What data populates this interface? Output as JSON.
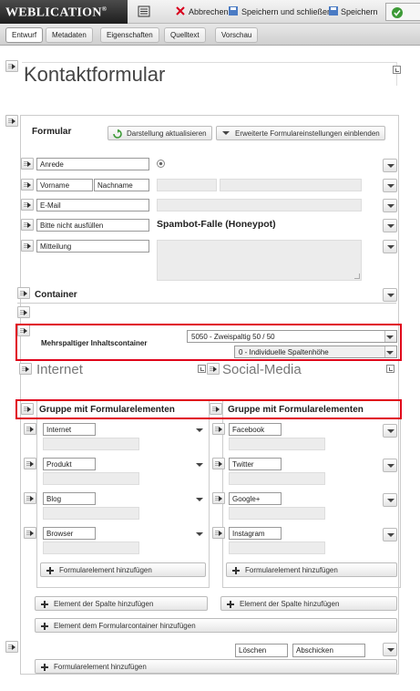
{
  "app": {
    "name": "WEBLICATION",
    "reg": "®"
  },
  "toolbar": {
    "cancel": "Abbrechen",
    "save_close": "Speichern und schließen",
    "save": "Speichern"
  },
  "tabs": [
    "Entwurf",
    "Metadaten",
    "Eigenschaften",
    "Quelltext",
    "Vorschau"
  ],
  "page_title": "Kontaktformular",
  "form": {
    "heading": "Formular",
    "refresh": "Darstellung aktualisieren",
    "advanced": "Erweiterte Formulareinstellungen einblenden",
    "fields": {
      "anrede": "Anrede",
      "vorname": "Vorname",
      "nachname": "Nachname",
      "email": "E-Mail",
      "honeypot_label": "Bitte nicht ausfüllen",
      "honeypot_title": "Spambot-Falle (Honeypot)",
      "mitteilung": "Mitteilung"
    }
  },
  "container": {
    "heading": "Container",
    "multi_label": "Mehrspaltiger Inhaltscontainer",
    "layout_value": "5050 - Zweispaltig 50 / 50",
    "height_value": "0 - Individuelle Spaltenhöhe",
    "col_left": "Internet",
    "col_right": "Social-Media",
    "group_title": "Gruppe mit Formularelementen",
    "left_items": [
      "Internet",
      "Produkt",
      "Blog",
      "Browser"
    ],
    "right_items": [
      "Facebook",
      "Twitter",
      "Google+",
      "Instagram"
    ],
    "add_form_element": "Formularelement hinzufügen",
    "add_column_element": "Element der Spalte hinzufügen",
    "add_container_element": "Element dem Formularcontainer hinzufügen"
  },
  "footer": {
    "delete": "Löschen",
    "submit": "Abschicken",
    "add_form_element": "Formularelement hinzufügen"
  }
}
